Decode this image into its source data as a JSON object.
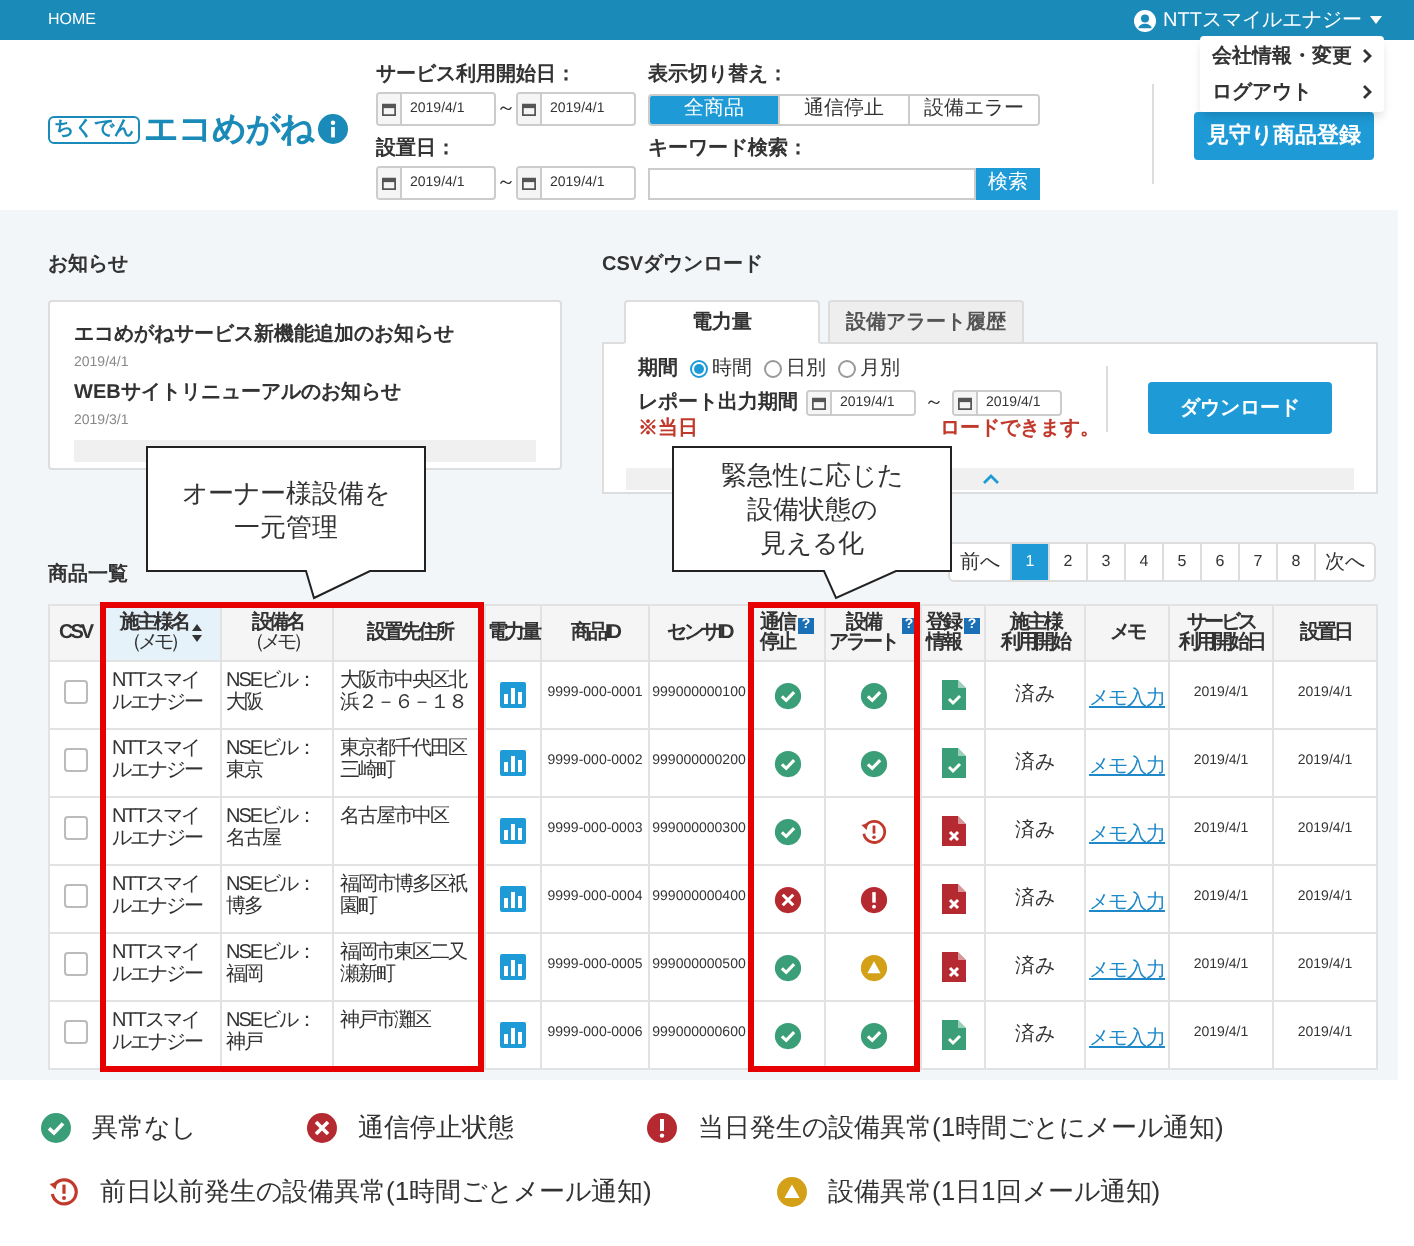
{
  "header": {
    "home": "HOME",
    "user": "NTTスマイルエナジー"
  },
  "user_menu": [
    {
      "label": "会社情報・変更"
    },
    {
      "label": "ログアウト"
    }
  ],
  "logo": {
    "badge": "ちくでん",
    "name": "エコめがね"
  },
  "date_ranges": [
    {
      "label": "サービス利用開始日：",
      "from": "2019/4/1",
      "sep": "～",
      "to": "2019/4/1"
    },
    {
      "label": "設置日：",
      "from": "2019/4/1",
      "sep": "～",
      "to": "2019/4/1"
    }
  ],
  "view_switch": {
    "label": "表示切り替え：",
    "options": [
      {
        "label": "全商品",
        "selected": true
      },
      {
        "label": "通信停止",
        "selected": false
      },
      {
        "label": "設備エラー",
        "selected": false
      }
    ]
  },
  "keyword": {
    "label": "キーワード検索：",
    "button": "検索"
  },
  "register_button": "見守り商品登録",
  "notices": {
    "title": "お知らせ",
    "items": [
      {
        "title": "エコめがねサービス新機能追加のお知らせ",
        "date": "2019/4/1"
      },
      {
        "title": "WEBサイトリニューアルのお知らせ",
        "date": "2019/3/1"
      }
    ]
  },
  "csv": {
    "title": "CSVダウンロード",
    "tabs": [
      {
        "label": "電力量",
        "selected": true
      },
      {
        "label": "設備アラート履歴",
        "selected": false
      }
    ],
    "period_label": "期間",
    "period_options": [
      {
        "label": "時間",
        "selected": true
      },
      {
        "label": "日別",
        "selected": false
      },
      {
        "label": "月別",
        "selected": false
      }
    ],
    "report_label": "レポート出力期間",
    "from": "2019/4/1",
    "sep": "～",
    "to": "2019/4/1",
    "note_start": "※当日",
    "note_end": "ロードできます。",
    "download": "ダウンロード"
  },
  "list": {
    "title": "商品一覧",
    "pagination": {
      "prev": "前へ",
      "pages": [
        {
          "label": "1",
          "selected": true
        },
        {
          "label": "2",
          "selected": false
        },
        {
          "label": "3",
          "selected": false
        },
        {
          "label": "4",
          "selected": false
        },
        {
          "label": "5",
          "selected": false
        },
        {
          "label": "6",
          "selected": false
        },
        {
          "label": "7",
          "selected": false
        },
        {
          "label": "8",
          "selected": false
        }
      ],
      "next": "次へ"
    }
  },
  "table": {
    "columns": [
      {
        "lines": [
          "CSV"
        ]
      },
      {
        "lines": [
          "施主様名"
        ],
        "note": "（メモ）",
        "sorted": true
      },
      {
        "lines": [
          "設備名"
        ],
        "note": "（メモ）",
        "sorted": false
      },
      {
        "lines": [
          "設置先住所"
        ]
      },
      {
        "lines": [
          "電力量"
        ]
      },
      {
        "lines": [
          "商品ID"
        ]
      },
      {
        "lines": [
          "センサID"
        ]
      },
      {
        "lines": [
          "通信",
          "停止"
        ],
        "help": "?"
      },
      {
        "lines": [
          "設備",
          "アラート"
        ],
        "help": "?"
      },
      {
        "lines": [
          "登録",
          "情報"
        ],
        "help": "?"
      },
      {
        "lines": [
          "施主様",
          "利用開始"
        ]
      },
      {
        "lines": [
          "メモ"
        ]
      },
      {
        "lines": [
          "サービス",
          "利用開始日"
        ]
      },
      {
        "lines": [
          "設置日"
        ]
      }
    ],
    "rows": [
      {
        "checked": false,
        "owner": "NTTスマイルエナジー",
        "facility": "NSEビル：大阪",
        "address": "大阪市中央区北浜２－６－１８",
        "product_id": "9999-000-0001",
        "sensor_id": "999000000100",
        "comm": {
          "kind": "ok"
        },
        "alert": {
          "kind": "ok"
        },
        "registration": {
          "kind": "ok"
        },
        "owner_started": "済み",
        "memo": "メモ入力",
        "service_start": "2019/4/1",
        "installed": "2019/4/1"
      },
      {
        "checked": false,
        "owner": "NTTスマイルエナジー",
        "facility": "NSEビル：東京",
        "address": "東京都千代田区三崎町",
        "product_id": "9999-000-0002",
        "sensor_id": "999000000200",
        "comm": {
          "kind": "ok"
        },
        "alert": {
          "kind": "ok"
        },
        "registration": {
          "kind": "ok"
        },
        "owner_started": "済み",
        "memo": "メモ入力",
        "service_start": "2019/4/1",
        "installed": "2019/4/1"
      },
      {
        "checked": false,
        "owner": "NTTスマイルエナジー",
        "facility": "NSEビル：名古屋",
        "address": "名古屋市中区",
        "product_id": "9999-000-0003",
        "sensor_id": "999000000300",
        "comm": {
          "kind": "ok"
        },
        "alert": {
          "kind": "past"
        },
        "registration": {
          "kind": "missing"
        },
        "owner_started": "済み",
        "memo": "メモ入力",
        "service_start": "2019/4/1",
        "installed": "2019/4/1"
      },
      {
        "checked": false,
        "owner": "NTTスマイルエナジー",
        "facility": "NSEビル：博多",
        "address": "福岡市博多区祇園町",
        "product_id": "9999-000-0004",
        "sensor_id": "999000000400",
        "comm": {
          "kind": "stopped"
        },
        "alert": {
          "kind": "today"
        },
        "registration": {
          "kind": "missing"
        },
        "owner_started": "済み",
        "memo": "メモ入力",
        "service_start": "2019/4/1",
        "installed": "2019/4/1"
      },
      {
        "checked": false,
        "owner": "NTTスマイルエナジー",
        "facility": "NSEビル：福岡",
        "address": "福岡市東区二又瀬新町",
        "product_id": "9999-000-0005",
        "sensor_id": "999000000500",
        "comm": {
          "kind": "ok"
        },
        "alert": {
          "kind": "daily"
        },
        "registration": {
          "kind": "missing"
        },
        "owner_started": "済み",
        "memo": "メモ入力",
        "service_start": "2019/4/1",
        "installed": "2019/4/1"
      },
      {
        "checked": false,
        "owner": "NTTスマイルエナジー",
        "facility": "NSEビル：神戸",
        "address": "神戸市灘区",
        "product_id": "9999-000-0006",
        "sensor_id": "999000000600",
        "comm": {
          "kind": "ok"
        },
        "alert": {
          "kind": "ok"
        },
        "registration": {
          "kind": "ok"
        },
        "owner_started": "済み",
        "memo": "メモ入力",
        "service_start": "2019/4/1",
        "installed": "2019/4/1"
      }
    ]
  },
  "callouts": [
    {
      "lines": [
        "オーナー様設備を",
        "一元管理"
      ]
    },
    {
      "lines": [
        "緊急性に応じた",
        "設備状態の",
        "見える化"
      ]
    }
  ],
  "legend": [
    {
      "kind": "ok",
      "label": "異常なし"
    },
    {
      "kind": "stopped",
      "label": "通信停止状態"
    },
    {
      "kind": "today",
      "label": "当日発生の設備異常(1時間ごとにメール通知)"
    },
    {
      "kind": "past",
      "label": "前日以前発生の設備異常(1時間ごとメール通知)"
    },
    {
      "kind": "daily",
      "label": "設備異常(1日1回メール通知)"
    }
  ]
}
